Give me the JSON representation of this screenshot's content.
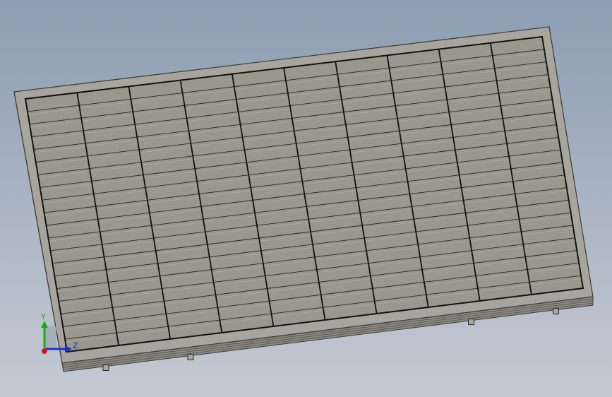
{
  "viewport": {
    "background_top": "#8d9db3",
    "background_bottom": "#c5cad3"
  },
  "model": {
    "name": "solar-panel",
    "frame_color": "#a8a59c",
    "frame_edge_color": "#3a3a36",
    "cell_color": "#9a978d",
    "cell_line_color": "#111111",
    "columns": 10,
    "rows": 20
  },
  "triad": {
    "x_color": "#d01a1a",
    "y_color": "#1fa81f",
    "z_color": "#1a2ed0",
    "y_label": "Y",
    "z_label": "Z"
  }
}
